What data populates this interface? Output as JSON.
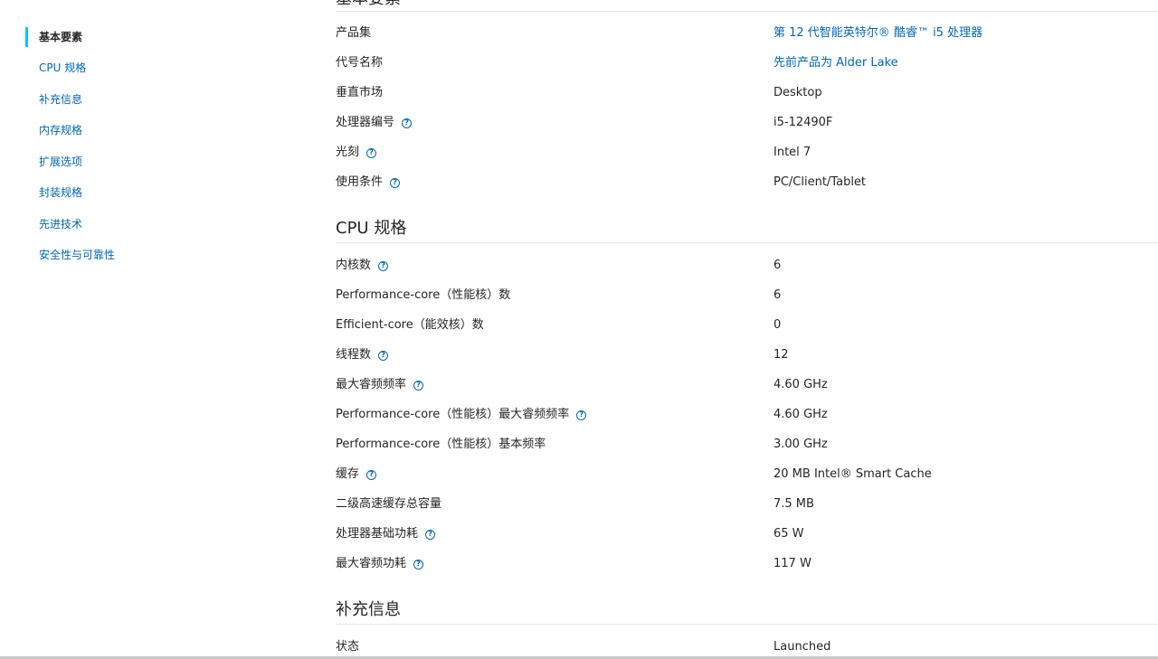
{
  "sidebar": {
    "items": [
      {
        "label": "基本要素",
        "active": true
      },
      {
        "label": "CPU 规格"
      },
      {
        "label": "补充信息"
      },
      {
        "label": "内存规格"
      },
      {
        "label": "扩展选项"
      },
      {
        "label": "封装规格"
      },
      {
        "label": "先进技术"
      },
      {
        "label": "安全性与可靠性"
      }
    ]
  },
  "sections": {
    "essentials": {
      "title": "基本要素",
      "rows": [
        {
          "label": "产品集",
          "value": "第 12 代智能英特尔® 酷睿™ i5 处理器",
          "link": true,
          "help": false
        },
        {
          "label": "代号名称",
          "value": "先前产品为 Alder Lake",
          "link": true,
          "help": false
        },
        {
          "label": "垂直市场",
          "value": "Desktop",
          "help": false
        },
        {
          "label": "处理器编号",
          "value": "i5-12490F",
          "help": true
        },
        {
          "label": "光刻",
          "value": "Intel 7",
          "help": true
        },
        {
          "label": "使用条件",
          "value": "PC/Client/Tablet",
          "help": true
        }
      ]
    },
    "cpu": {
      "title": "CPU 规格",
      "rows": [
        {
          "label": "内核数",
          "value": "6",
          "help": true
        },
        {
          "label": "Performance-core（性能核）数",
          "value": "6",
          "help": false
        },
        {
          "label": "Efficient-core（能效核）数",
          "value": "0",
          "help": false
        },
        {
          "label": "线程数",
          "value": "12",
          "help": true
        },
        {
          "label": "最大睿频频率",
          "value": "4.60 GHz",
          "help": true
        },
        {
          "label": "Performance-core（性能核）最大睿频频率",
          "value": "4.60 GHz",
          "help": true
        },
        {
          "label": "Performance-core（性能核）基本频率",
          "value": "3.00 GHz",
          "help": false
        },
        {
          "label": "缓存",
          "value": "20 MB Intel® Smart Cache",
          "help": true
        },
        {
          "label": "二级高速缓存总容量",
          "value": "7.5 MB",
          "help": false
        },
        {
          "label": "处理器基础功耗",
          "value": "65 W",
          "help": true
        },
        {
          "label": "最大睿频功耗",
          "value": "117 W",
          "help": true
        }
      ]
    },
    "supplemental": {
      "title": "补充信息",
      "rows": [
        {
          "label": "状态",
          "value": "Launched",
          "help": false
        }
      ]
    }
  },
  "icons": {
    "help": "help-circle-icon"
  },
  "colors": {
    "link": "#0068b5",
    "accent": "#00c7fd",
    "text": "#262626"
  }
}
